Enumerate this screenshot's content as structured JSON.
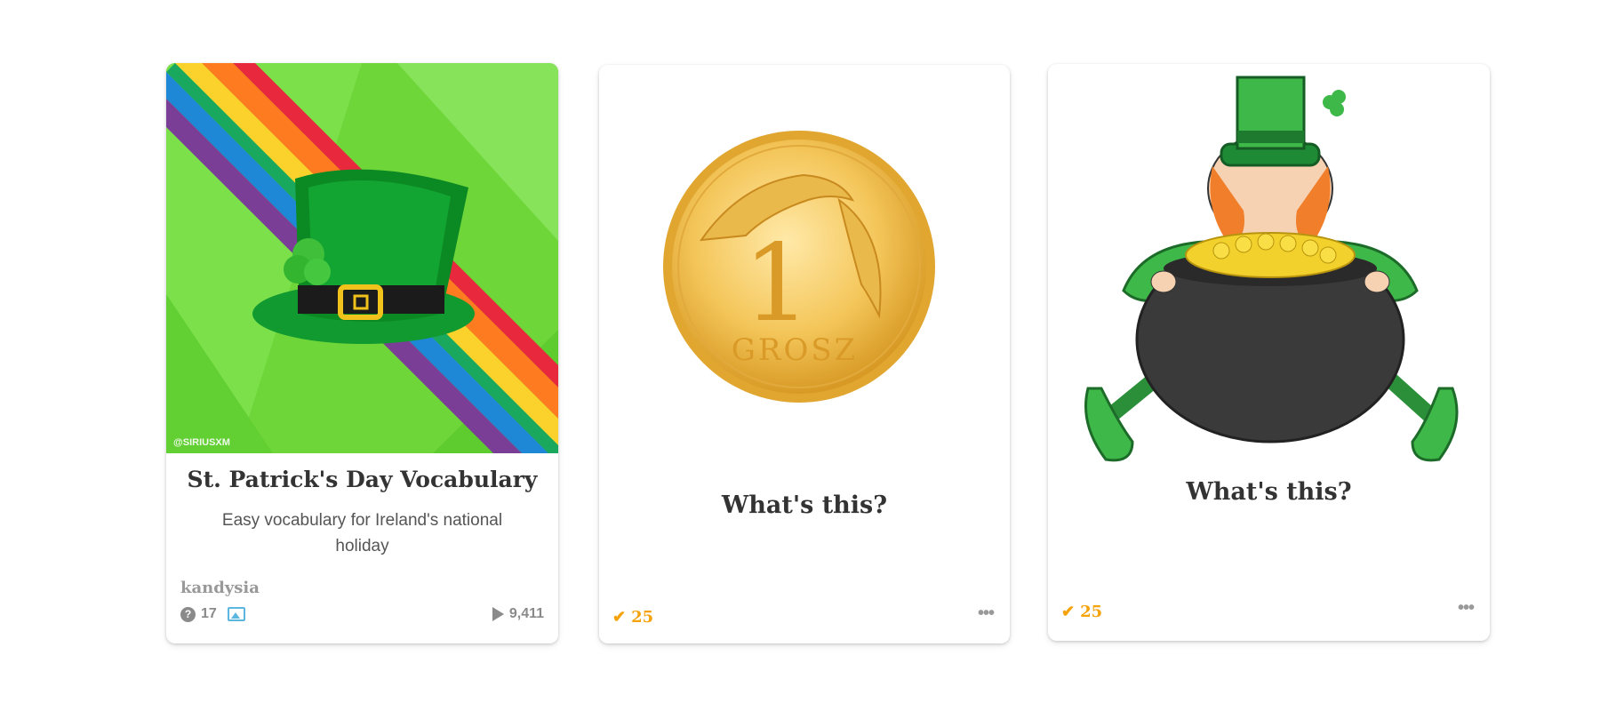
{
  "deck": {
    "title": "St. Patrick's Day Vocabulary",
    "description": "Easy vocabulary for Ireland's national holiday",
    "author": "kandysia",
    "question_count": "17",
    "plays": "9,411",
    "watermark": "@SIRIUSXM",
    "cover_icon": "leprechaun-hat-image"
  },
  "questions": [
    {
      "prompt": "What's this?",
      "points": "25",
      "image_icon": "gold-coin-image",
      "coin_text_number": "1",
      "coin_text_word": "GROSZ"
    },
    {
      "prompt": "What's this?",
      "points": "25",
      "image_icon": "leprechaun-pot-of-gold-image"
    }
  ],
  "colors": {
    "accent_points": "#f5a20b",
    "title_text": "#333333",
    "muted_text": "#8a8a8a",
    "image_icon_blue": "#5bb7e0"
  },
  "more_label": "•••"
}
